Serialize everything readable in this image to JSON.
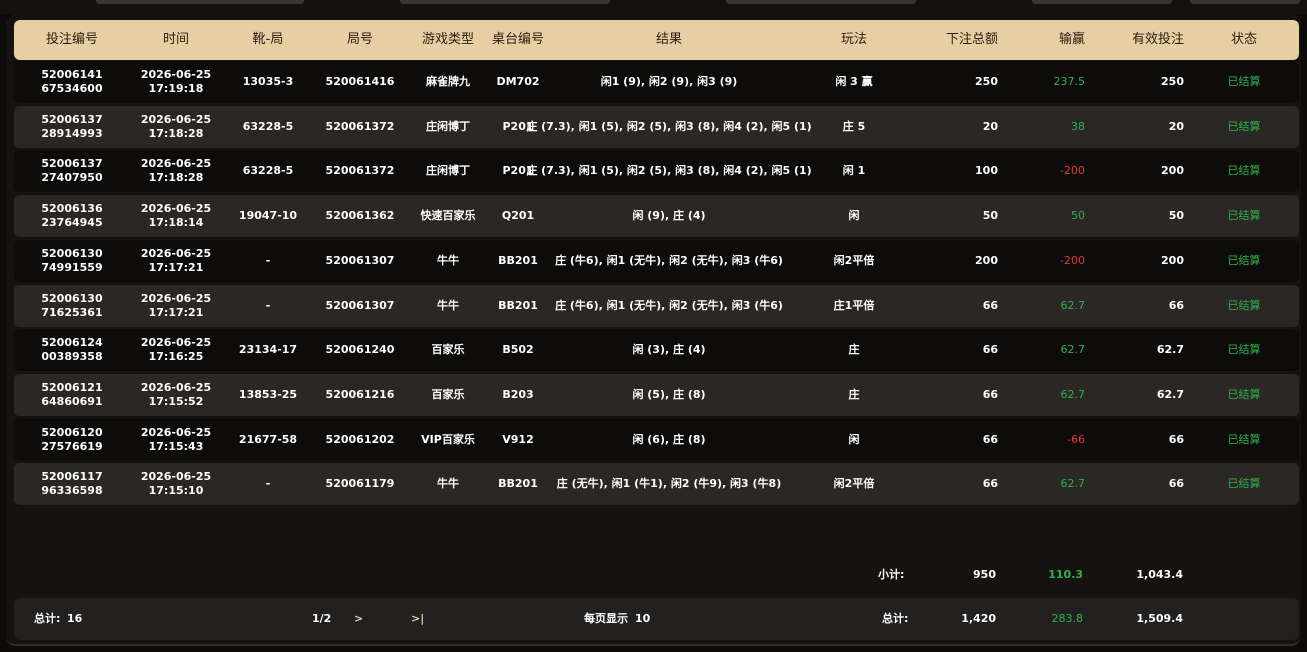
{
  "table": {
    "columns": [
      "投注编号",
      "时间",
      "靴-局",
      "局号",
      "游戏类型",
      "桌台编号",
      "结果",
      "玩法",
      "下注总额",
      "输赢",
      "有效投注",
      "状态"
    ],
    "rows": [
      {
        "id1": "52006141",
        "id2": "67534600",
        "date": "2026-06-25",
        "time": "17:19:18",
        "shoe": "13035-3",
        "round": "520061416",
        "game": "麻雀牌九",
        "table": "DM702",
        "result": "闲1 (9), 闲2 (9), 闲3 (9)",
        "play": "闲 3 赢",
        "bet": "250",
        "win": "237.5",
        "winSign": "pos",
        "valid": "250",
        "status": "已结算"
      },
      {
        "id1": "52006137",
        "id2": "28914993",
        "date": "2026-06-25",
        "time": "17:18:28",
        "shoe": "63228-5",
        "round": "520061372",
        "game": "庄闲博丁",
        "table": "P201",
        "result": "庄 (7.3), 闲1 (5), 闲2 (5), 闲3 (8), 闲4 (2), 闲5 (1)",
        "play": "庄 5",
        "bet": "20",
        "win": "38",
        "winSign": "pos",
        "valid": "20",
        "status": "已结算"
      },
      {
        "id1": "52006137",
        "id2": "27407950",
        "date": "2026-06-25",
        "time": "17:18:28",
        "shoe": "63228-5",
        "round": "520061372",
        "game": "庄闲博丁",
        "table": "P201",
        "result": "庄 (7.3), 闲1 (5), 闲2 (5), 闲3 (8), 闲4 (2), 闲5 (1)",
        "play": "闲 1",
        "bet": "100",
        "win": "-200",
        "winSign": "neg",
        "valid": "200",
        "status": "已结算"
      },
      {
        "id1": "52006136",
        "id2": "23764945",
        "date": "2026-06-25",
        "time": "17:18:14",
        "shoe": "19047-10",
        "round": "520061362",
        "game": "快速百家乐",
        "table": "Q201",
        "result": "闲 (9), 庄 (4)",
        "play": "闲",
        "bet": "50",
        "win": "50",
        "winSign": "pos",
        "valid": "50",
        "status": "已结算"
      },
      {
        "id1": "52006130",
        "id2": "74991559",
        "date": "2026-06-25",
        "time": "17:17:21",
        "shoe": "-",
        "round": "520061307",
        "game": "牛牛",
        "table": "BB201",
        "result": "庄 (牛6), 闲1 (无牛), 闲2 (无牛), 闲3 (牛6)",
        "play": "闲2平倍",
        "bet": "200",
        "win": "-200",
        "winSign": "neg",
        "valid": "200",
        "status": "已结算"
      },
      {
        "id1": "52006130",
        "id2": "71625361",
        "date": "2026-06-25",
        "time": "17:17:21",
        "shoe": "-",
        "round": "520061307",
        "game": "牛牛",
        "table": "BB201",
        "result": "庄 (牛6), 闲1 (无牛), 闲2 (无牛), 闲3 (牛6)",
        "play": "庄1平倍",
        "bet": "66",
        "win": "62.7",
        "winSign": "pos",
        "valid": "66",
        "status": "已结算"
      },
      {
        "id1": "52006124",
        "id2": "00389358",
        "date": "2026-06-25",
        "time": "17:16:25",
        "shoe": "23134-17",
        "round": "520061240",
        "game": "百家乐",
        "table": "B502",
        "result": "闲 (3), 庄 (4)",
        "play": "庄",
        "bet": "66",
        "win": "62.7",
        "winSign": "pos",
        "valid": "62.7",
        "status": "已结算"
      },
      {
        "id1": "52006121",
        "id2": "64860691",
        "date": "2026-06-25",
        "time": "17:15:52",
        "shoe": "13853-25",
        "round": "520061216",
        "game": "百家乐",
        "table": "B203",
        "result": "闲 (5), 庄 (8)",
        "play": "庄",
        "bet": "66",
        "win": "62.7",
        "winSign": "pos",
        "valid": "62.7",
        "status": "已结算"
      },
      {
        "id1": "52006120",
        "id2": "27576619",
        "date": "2026-06-25",
        "time": "17:15:43",
        "shoe": "21677-58",
        "round": "520061202",
        "game": "VIP百家乐",
        "table": "V912",
        "result": "闲 (6), 庄 (8)",
        "play": "闲",
        "bet": "66",
        "win": "-66",
        "winSign": "neg",
        "valid": "66",
        "status": "已结算"
      },
      {
        "id1": "52006117",
        "id2": "96336598",
        "date": "2026-06-25",
        "time": "17:15:10",
        "shoe": "-",
        "round": "520061179",
        "game": "牛牛",
        "table": "BB201",
        "result": "庄 (无牛), 闲1 (牛1), 闲2 (牛9), 闲3 (牛8)",
        "play": "闲2平倍",
        "bet": "66",
        "win": "62.7",
        "winSign": "pos",
        "valid": "66",
        "status": "已结算"
      }
    ]
  },
  "subtotal": {
    "label": "小计:",
    "bet": "950",
    "win": "110.3",
    "valid": "1,043.4"
  },
  "footer": {
    "count_label": "总计:",
    "count": "16",
    "page": "1/2",
    "next": ">",
    "last": ">|",
    "per_page_label": "每页显示",
    "per_page": "10",
    "total_label": "总计:",
    "total_bet": "1,420",
    "total_win": "283.8",
    "total_valid": "1,509.4"
  },
  "colors": {
    "header_bg": "#e8cfa3",
    "positive": "#2db34a",
    "negative": "#e03b2f"
  }
}
